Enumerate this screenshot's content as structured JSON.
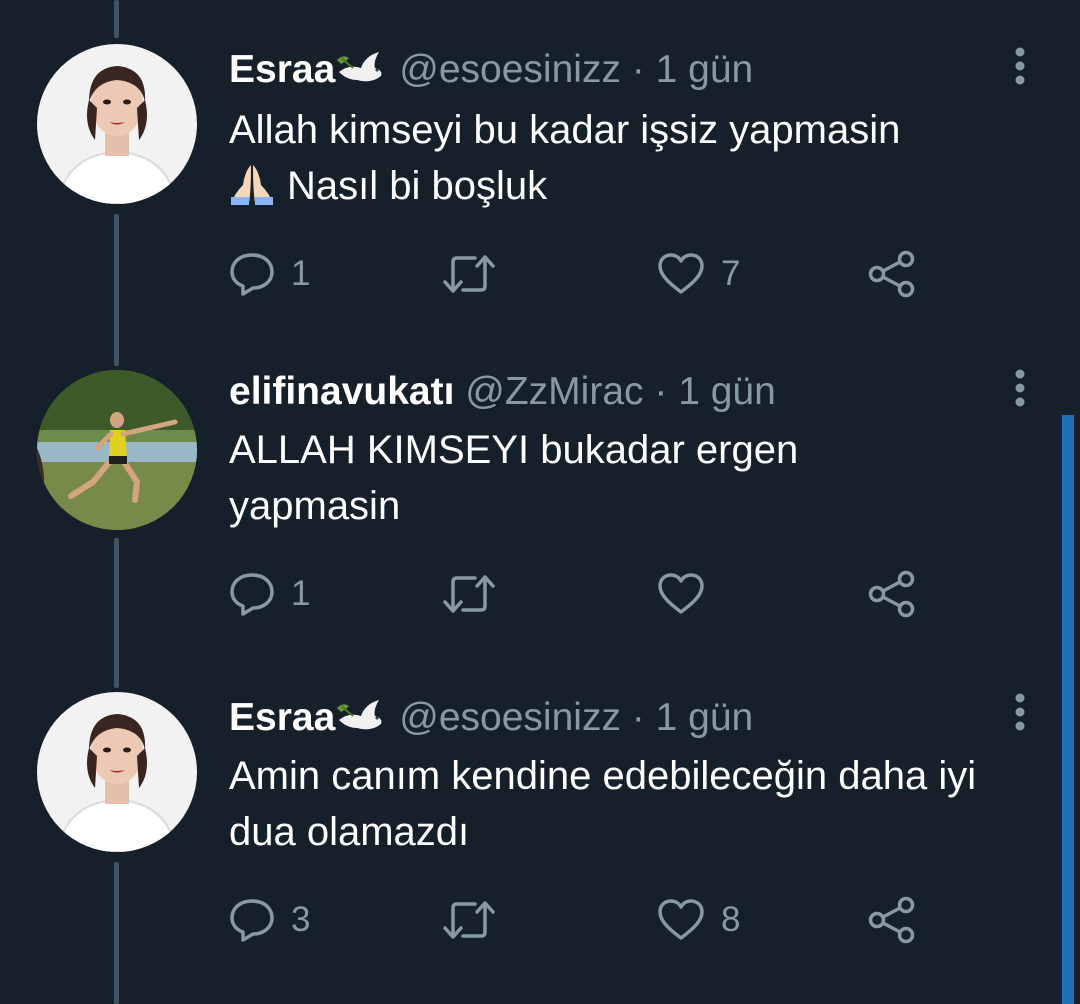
{
  "tweets": [
    {
      "name": "Esraa",
      "handle": "@esoesinizz",
      "separator": "·",
      "time": "1 gün",
      "text": "Allah kimseyi bu kadar işsiz yapmasin",
      "text2": "Nasıl bi boşluk",
      "emoji": "folded-hands-emoji",
      "name_badge": "dove-emoji",
      "avatar": "woman-portrait-avatar",
      "reply_count": "1",
      "retweet_count": "",
      "like_count": "7"
    },
    {
      "name": "elifinavukatı",
      "handle": "@ZzMirac",
      "separator": "·",
      "time": "1 gün",
      "text": "ALLAH KIMSEYI bukadar ergen yapmasin",
      "avatar": "athlete-running-avatar",
      "reply_count": "1",
      "retweet_count": "",
      "like_count": ""
    },
    {
      "name": "Esraa",
      "handle": "@esoesinizz",
      "separator": "·",
      "time": "1 gün",
      "text": "Amin canım kendine edebileceğin daha iyi dua olamazdı",
      "name_badge": "dove-emoji",
      "avatar": "woman-portrait-avatar",
      "reply_count": "3",
      "retweet_count": "",
      "like_count": "8"
    }
  ],
  "colors": {
    "background": "#15202b",
    "primary_text": "#ffffff",
    "secondary_text": "#8899a6",
    "thread_line": "#3d5466",
    "scrollbar": "#1d6fb8"
  },
  "icons": [
    "reply-icon",
    "retweet-icon",
    "like-icon",
    "share-icon",
    "more-options-icon"
  ]
}
